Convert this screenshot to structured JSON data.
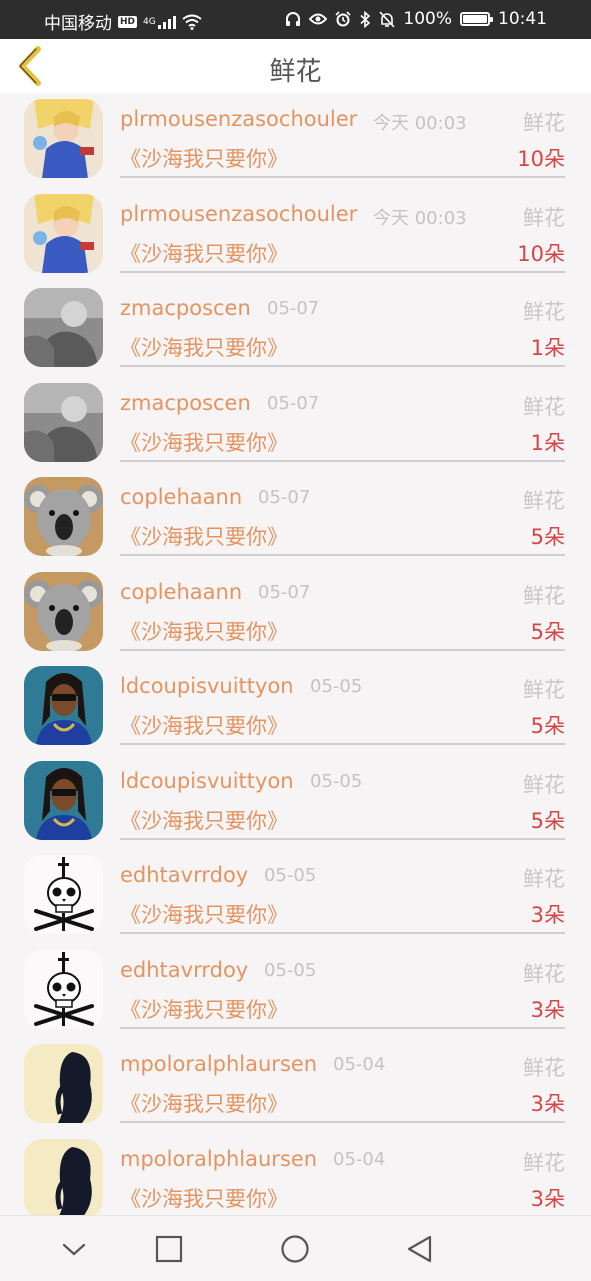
{
  "status_bar": {
    "carrier": "中国移动",
    "hd_badge": "HD",
    "network": "4G",
    "battery": "100%",
    "time": "10:41"
  },
  "header": {
    "title": "鲜花"
  },
  "rows": [
    {
      "username": "plrmousenzasochouler",
      "time": "今天 00:03",
      "gift_type": "鲜花",
      "song": "《沙海我只要你》",
      "count": "10朵",
      "avatar": "anime-girl"
    },
    {
      "username": "plrmousenzasochouler",
      "time": "今天 00:03",
      "gift_type": "鲜花",
      "song": "《沙海我只要你》",
      "count": "10朵",
      "avatar": "anime-girl"
    },
    {
      "username": "zmacposcen",
      "time": "05-07",
      "gift_type": "鲜花",
      "song": "《沙海我只要你》",
      "count": "1朵",
      "avatar": "grey-photo"
    },
    {
      "username": "zmacposcen",
      "time": "05-07",
      "gift_type": "鲜花",
      "song": "《沙海我只要你》",
      "count": "1朵",
      "avatar": "grey-photo"
    },
    {
      "username": "coplehaann",
      "time": "05-07",
      "gift_type": "鲜花",
      "song": "《沙海我只要你》",
      "count": "5朵",
      "avatar": "koala"
    },
    {
      "username": "coplehaann",
      "time": "05-07",
      "gift_type": "鲜花",
      "song": "《沙海我只要你》",
      "count": "5朵",
      "avatar": "koala"
    },
    {
      "username": "ldcoupisvuittyon",
      "time": "05-05",
      "gift_type": "鲜花",
      "song": "《沙海我只要你》",
      "count": "5朵",
      "avatar": "man-blue"
    },
    {
      "username": "ldcoupisvuittyon",
      "time": "05-05",
      "gift_type": "鲜花",
      "song": "《沙海我只要你》",
      "count": "5朵",
      "avatar": "man-blue"
    },
    {
      "username": "edhtavrrdoy",
      "time": "05-05",
      "gift_type": "鲜花",
      "song": "《沙海我只要你》",
      "count": "3朵",
      "avatar": "skull"
    },
    {
      "username": "edhtavrrdoy",
      "time": "05-05",
      "gift_type": "鲜花",
      "song": "《沙海我只要你》",
      "count": "3朵",
      "avatar": "skull"
    },
    {
      "username": "mpoloralphlaursen",
      "time": "05-04",
      "gift_type": "鲜花",
      "song": "《沙海我只要你》",
      "count": "3朵",
      "avatar": "woman-hair"
    },
    {
      "username": "mpoloralphlaursen",
      "time": "05-04",
      "gift_type": "鲜花",
      "song": "《沙海我只要你》",
      "count": "3朵",
      "avatar": "woman-hair"
    }
  ],
  "colors": {
    "username": "#e49460",
    "count": "#d64545",
    "back_arrow": "#e8c13a"
  },
  "nav_bar": {
    "icons": [
      "chevron-down-icon",
      "square-icon",
      "circle-icon",
      "triangle-back-icon"
    ]
  }
}
